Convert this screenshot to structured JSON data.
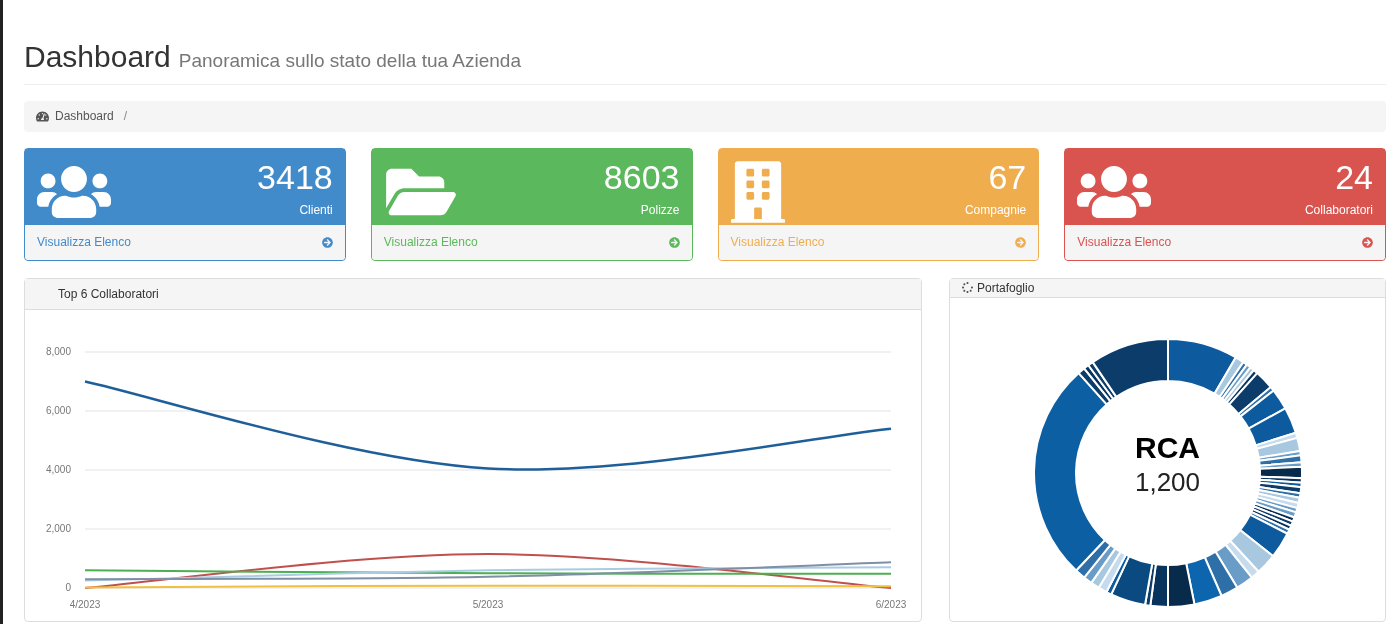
{
  "header": {
    "title": "Dashboard",
    "subtitle": "Panoramica sullo stato della tua Azienda"
  },
  "breadcrumb": {
    "items": [
      "Dashboard"
    ],
    "separator": "/"
  },
  "stat_cards": [
    {
      "kind": "users",
      "color": "#428bca",
      "value": "3418",
      "label": "Clienti",
      "link": "Visualizza Elenco"
    },
    {
      "kind": "folder",
      "color": "#5cb85c",
      "value": "8603",
      "label": "Polizze",
      "link": "Visualizza Elenco"
    },
    {
      "kind": "building",
      "color": "#f0ad4e",
      "value": "67",
      "label": "Compagnie",
      "link": "Visualizza Elenco"
    },
    {
      "kind": "users",
      "color": "#d9534f",
      "value": "24",
      "label": "Collaboratori",
      "link": "Visualizza Elenco"
    }
  ],
  "collaborators_panel": {
    "title": "Top 6 Collaboratori",
    "chart_data": {
      "type": "line",
      "grid": true,
      "categories": [
        "4/2023",
        "5/2023",
        "6/2023"
      ],
      "ylim": [
        0,
        8000
      ],
      "yticks": [
        {
          "value": 0,
          "label": "0"
        },
        {
          "value": 2000,
          "label": "2,000"
        },
        {
          "value": 4000,
          "label": "4,000"
        },
        {
          "value": 6000,
          "label": "6,000"
        },
        {
          "value": 8000,
          "label": "8,000"
        }
      ],
      "series": [
        {
          "color": "#1f5f99",
          "values": [
            7000,
            4050,
            5400
          ]
        },
        {
          "color": "#c0504d",
          "values": [
            0,
            1150,
            0
          ]
        },
        {
          "color": "#4caf50",
          "values": [
            600,
            500,
            480
          ]
        },
        {
          "color": "#a9cce3",
          "values": [
            250,
            600,
            700
          ]
        },
        {
          "color": "#7f8fa6",
          "values": [
            300,
            380,
            870
          ]
        },
        {
          "color": "#f0c040",
          "values": [
            20,
            80,
            60
          ]
        }
      ]
    }
  },
  "portfolio_panel": {
    "title": "Portafoglio",
    "center_label": "RCA",
    "center_value": "1,200"
  }
}
